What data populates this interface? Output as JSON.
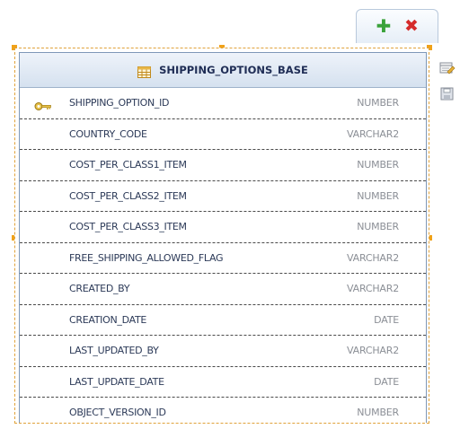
{
  "toolbar": {
    "add_icon": "plus-icon",
    "delete_icon": "x-icon",
    "add_color": "#3aa23a",
    "delete_color": "#d52b2b"
  },
  "side_icons": [
    "edit-table-icon",
    "save-icon"
  ],
  "entity": {
    "title": "SHIPPING_OPTIONS_BASE",
    "header_icon": "table-icon",
    "border_color": "#e0a23a",
    "columns": [
      {
        "name": "SHIPPING_OPTION_ID",
        "type": "NUMBER",
        "primary_key": true
      },
      {
        "name": "COUNTRY_CODE",
        "type": "VARCHAR2",
        "primary_key": false
      },
      {
        "name": "COST_PER_CLASS1_ITEM",
        "type": "NUMBER",
        "primary_key": false
      },
      {
        "name": "COST_PER_CLASS2_ITEM",
        "type": "NUMBER",
        "primary_key": false
      },
      {
        "name": "COST_PER_CLASS3_ITEM",
        "type": "NUMBER",
        "primary_key": false
      },
      {
        "name": "FREE_SHIPPING_ALLOWED_FLAG",
        "type": "VARCHAR2",
        "primary_key": false
      },
      {
        "name": "CREATED_BY",
        "type": "VARCHAR2",
        "primary_key": false
      },
      {
        "name": "CREATION_DATE",
        "type": "DATE",
        "primary_key": false
      },
      {
        "name": "LAST_UPDATED_BY",
        "type": "VARCHAR2",
        "primary_key": false
      },
      {
        "name": "LAST_UPDATE_DATE",
        "type": "DATE",
        "primary_key": false
      },
      {
        "name": "OBJECT_VERSION_ID",
        "type": "NUMBER",
        "primary_key": false
      }
    ]
  }
}
